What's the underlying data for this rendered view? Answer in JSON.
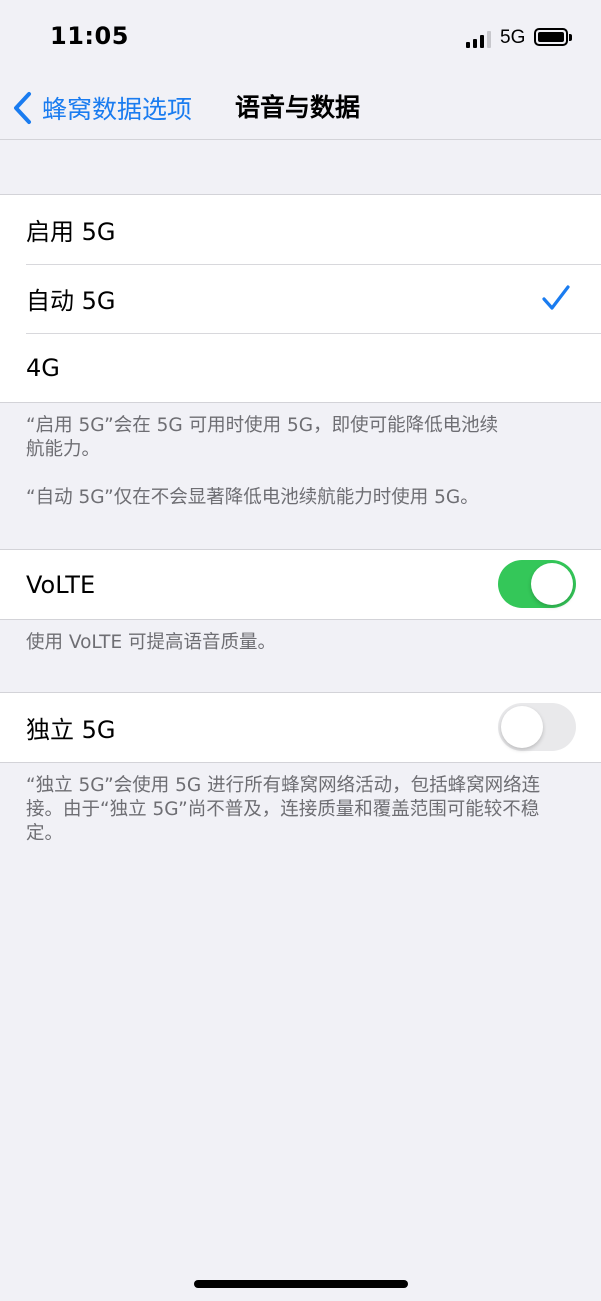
{
  "status_bar": {
    "time": "11:05",
    "network": "5G",
    "icons": [
      "signal-icon",
      "battery-icon"
    ]
  },
  "nav": {
    "back_label": "蜂窝数据选项",
    "title": "语音与数据",
    "back_icon": "chevron-left-icon",
    "accent": "#1a7cf0"
  },
  "network_mode": {
    "options": [
      {
        "label": "启用 5G",
        "selected": false
      },
      {
        "label": "自动 5G",
        "selected": true
      },
      {
        "label": "4G",
        "selected": false
      }
    ],
    "check_icon": "checkmark-icon",
    "footer": [
      "“启用 5G”会在 5G 可用时使用 5G，即使可能降低电池续航能力。",
      "“自动 5G”仅在不会显著降低电池续航能力时使用 5G。"
    ]
  },
  "volte": {
    "label": "VoLTE",
    "enabled": true,
    "footer": "使用 VoLTE 可提高语音质量。",
    "on_color": "#34c759"
  },
  "standalone_5g": {
    "label": "独立 5G",
    "enabled": false,
    "footer": "“独立 5G”会使用 5G 进行所有蜂窝网络活动，包括蜂窝网络连接。由于“独立 5G”尚不普及，连接质量和覆盖范围可能较不稳定。"
  }
}
